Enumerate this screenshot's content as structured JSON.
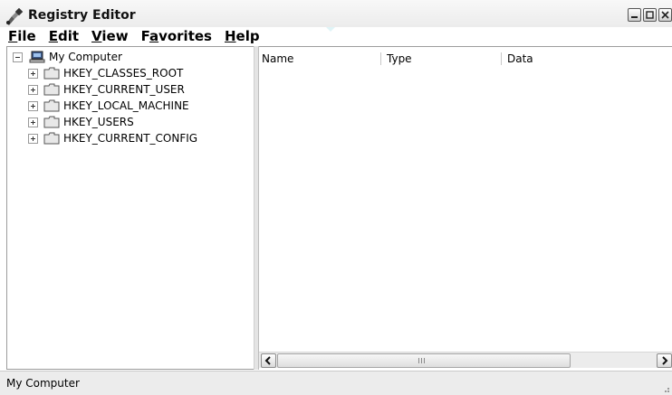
{
  "window": {
    "title": "Registry Editor",
    "icon": "registry-editor-icon",
    "controls": [
      "minimize-icon",
      "maximize-icon",
      "close-icon"
    ]
  },
  "menu": {
    "items": [
      {
        "accel": "F",
        "rest": "ile"
      },
      {
        "accel": "E",
        "rest": "dit"
      },
      {
        "accel": "V",
        "rest": "iew"
      },
      {
        "pre": "F",
        "accel": "a",
        "rest": "vorites"
      },
      {
        "accel": "H",
        "rest": "elp"
      }
    ]
  },
  "tree": {
    "root": {
      "label": "My Computer",
      "icon": "computer-icon",
      "expander": "collapse-icon"
    },
    "children": [
      {
        "label": "HKEY_CLASSES_ROOT",
        "icon": "folder-icon",
        "expander": "expand-icon"
      },
      {
        "label": "HKEY_CURRENT_USER",
        "icon": "folder-icon",
        "expander": "expand-icon"
      },
      {
        "label": "HKEY_LOCAL_MACHINE",
        "icon": "folder-icon",
        "expander": "expand-icon"
      },
      {
        "label": "HKEY_USERS",
        "icon": "folder-icon",
        "expander": "expand-icon"
      },
      {
        "label": "HKEY_CURRENT_CONFIG",
        "icon": "folder-icon",
        "expander": "expand-icon"
      }
    ]
  },
  "list": {
    "columns": [
      "Name",
      "Type",
      "Data"
    ]
  },
  "statusbar": {
    "text": "My Computer"
  },
  "colors": {
    "watermark": "#cfeff3",
    "border": "#9c9c9c",
    "chrome": "#ececec"
  }
}
